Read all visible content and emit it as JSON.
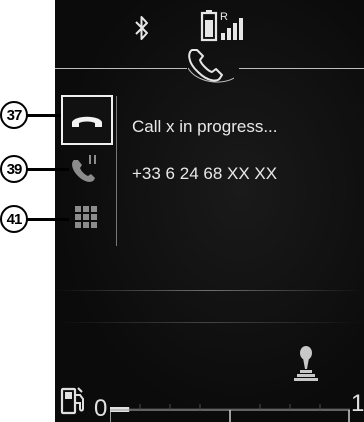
{
  "status_bar": {
    "bluetooth_icon": "bluetooth-icon",
    "battery_signal_icon": "battery-roaming-signal-icon",
    "roaming_label": "R"
  },
  "header": {
    "icon": "phone-handset-icon"
  },
  "callouts": {
    "hangup": "37",
    "hold": "39",
    "keypad": "41"
  },
  "side_buttons": [
    {
      "id": "hangup",
      "icon": "hang-up-icon",
      "highlighted": true
    },
    {
      "id": "hold",
      "icon": "hold-call-icon",
      "highlighted": false
    },
    {
      "id": "keypad",
      "icon": "keypad-icon",
      "highlighted": false
    }
  ],
  "call": {
    "status": "Call x in progress...",
    "number": "+33 6 24 68 XX XX"
  },
  "bottom": {
    "fuel_icon": "fuel-pump-icon",
    "gear_icon": "gear-shift-icon",
    "gauge_min": "0",
    "gauge_max": "1",
    "gauge_level": 0.08
  },
  "colors": {
    "screen_bg": "#0b0b0b",
    "text": "#e8e8e8",
    "accent_gray": "#bdbdbd"
  }
}
